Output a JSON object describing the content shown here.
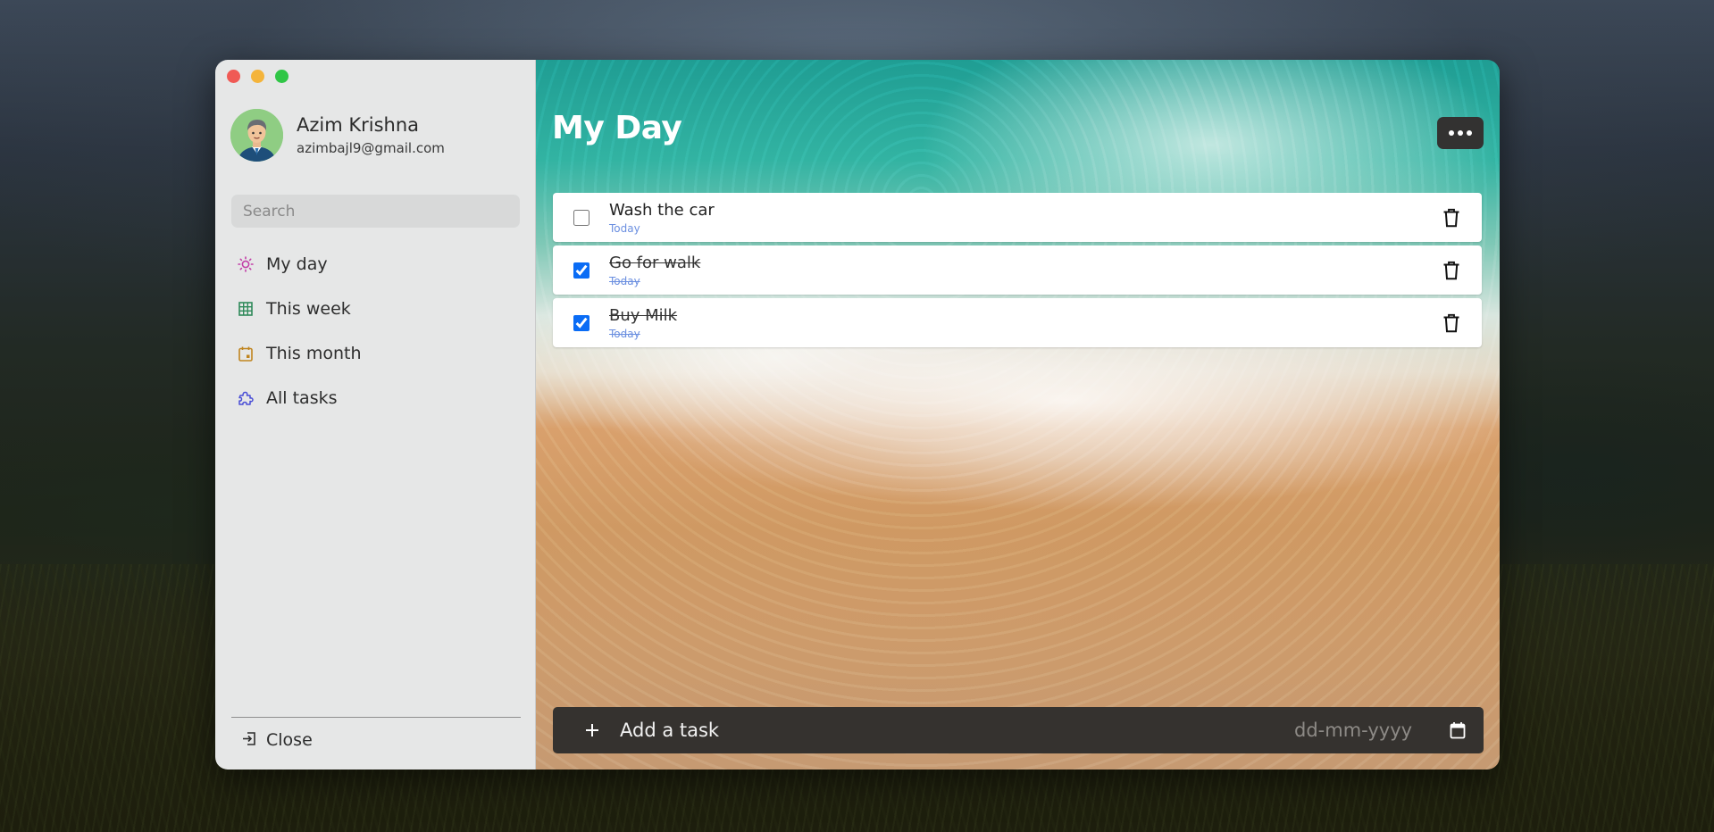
{
  "user": {
    "name": "Azim Krishna",
    "email": "azimbajl9@gmail.com"
  },
  "search": {
    "placeholder": "Search"
  },
  "nav": {
    "items": [
      {
        "label": "My day",
        "icon": "sun-icon",
        "color": "#c23fa7"
      },
      {
        "label": "This week",
        "icon": "grid-icon",
        "color": "#2f8a5a"
      },
      {
        "label": "This month",
        "icon": "calendar-icon",
        "color": "#c0851f"
      },
      {
        "label": "All tasks",
        "icon": "puzzle-icon",
        "color": "#4a4fd6"
      }
    ],
    "close_label": "Close"
  },
  "main": {
    "title": "My Day",
    "tasks": [
      {
        "title": "Wash the car",
        "date": "Today",
        "completed": false
      },
      {
        "title": "Go for walk",
        "date": "Today",
        "completed": true
      },
      {
        "title": "Buy Milk",
        "date": "Today",
        "completed": true
      }
    ],
    "add_task": {
      "placeholder": "Add a task",
      "date_placeholder": "dd-mm-yyyy"
    }
  },
  "colors": {
    "accent": "#0a6cf5",
    "task_date": "#6b8fe0",
    "addbar_bg": "#35322f"
  }
}
